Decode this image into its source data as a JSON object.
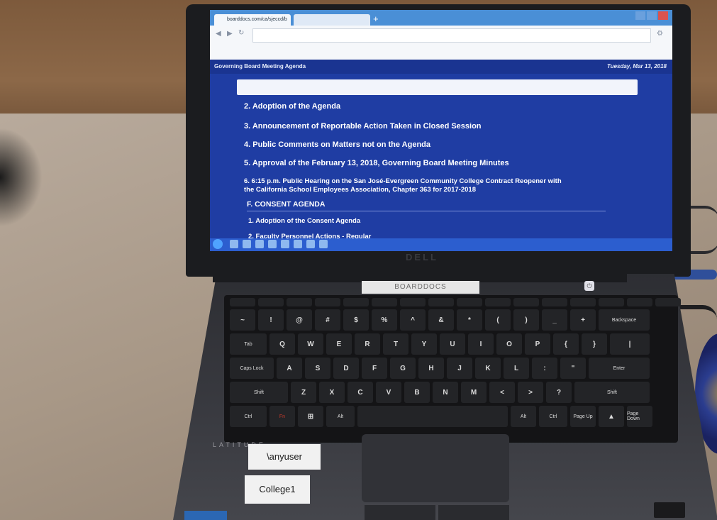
{
  "browser": {
    "tab_active": "boarddocs.com/ca/sjeccd/b",
    "tab_inactive": ""
  },
  "page": {
    "header_title": "Governing Board Meeting Agenda",
    "header_date": "Tuesday, Mar 13, 2018"
  },
  "agenda": {
    "items": [
      "2. Adoption of the Agenda",
      "3. Announcement of Reportable Action Taken in Closed Session",
      "4. Public Comments on Matters not on the Agenda",
      "5. Approval of the February 13, 2018, Governing Board Meeting Minutes",
      "6. 6:15 p.m. Public Hearing on the San José-Evergreen Community College Contract Reopener with",
      "the California School Employees Association, Chapter 363 for 2017-2018"
    ],
    "section": "F. CONSENT AGENDA",
    "sub_items": [
      "1. Adoption of the Consent Agenda",
      "2. Faculty Personnel Actions - Regular"
    ]
  },
  "laptop": {
    "brand": "DELL",
    "model": "LATITUDE",
    "asset_label": "BOARDDOCS",
    "sticker_user": "\\anyuser",
    "sticker_college": "College1"
  },
  "keyboard": {
    "row1": [
      "~",
      "!",
      "@",
      "#",
      "$",
      "%",
      "^",
      "&",
      "*",
      "(",
      ")",
      "_",
      "+",
      "Backspace"
    ],
    "row2": [
      "Tab",
      "Q",
      "W",
      "E",
      "R",
      "T",
      "Y",
      "U",
      "I",
      "O",
      "P",
      "{",
      "}",
      "|"
    ],
    "row3": [
      "Caps Lock",
      "A",
      "S",
      "D",
      "F",
      "G",
      "H",
      "J",
      "K",
      "L",
      ":",
      "\"",
      "Enter"
    ],
    "row4": [
      "Shift",
      "Z",
      "X",
      "C",
      "V",
      "B",
      "N",
      "M",
      "<",
      ">",
      "?",
      "Shift"
    ],
    "row5": [
      "Ctrl",
      "Fn",
      "",
      "Alt",
      "",
      "Alt",
      "Ctrl",
      "Page Up",
      "",
      "Page Down"
    ]
  },
  "colors": {
    "screen_bg": "#1f3da3",
    "tabbar": "#4a8fd6",
    "laptop_body": "#2d2e33"
  }
}
